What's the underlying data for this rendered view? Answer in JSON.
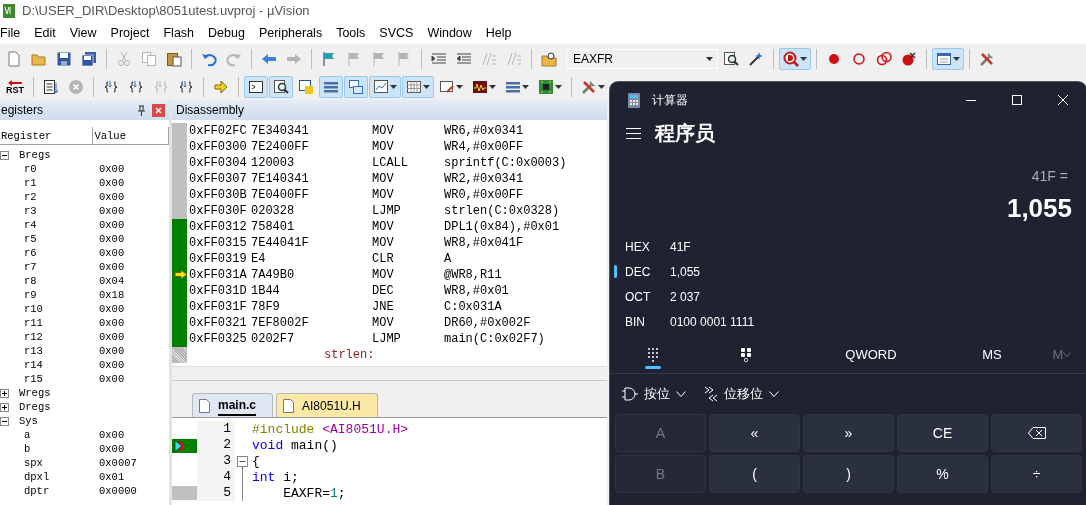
{
  "window": {
    "title": "D:\\USER_DIR\\Desktop\\8051utest.uvproj - µVision"
  },
  "menu": [
    "File",
    "Edit",
    "View",
    "Project",
    "Flash",
    "Debug",
    "Peripherals",
    "Tools",
    "SVCS",
    "Window",
    "Help"
  ],
  "toolbar_1": [
    {
      "kind": "new",
      "disabled": false,
      "pressed": false,
      "dropdown": false
    },
    {
      "kind": "open",
      "disabled": false,
      "pressed": false,
      "dropdown": false
    },
    {
      "kind": "save",
      "disabled": false,
      "pressed": false,
      "dropdown": false
    },
    {
      "kind": "saveall",
      "disabled": false,
      "pressed": false,
      "dropdown": false
    },
    {
      "kind": "separator"
    },
    {
      "kind": "cut",
      "disabled": true,
      "pressed": false,
      "dropdown": false
    },
    {
      "kind": "copy",
      "disabled": true,
      "pressed": false,
      "dropdown": false
    },
    {
      "kind": "paste",
      "disabled": false,
      "pressed": false,
      "dropdown": false
    },
    {
      "kind": "separator"
    },
    {
      "kind": "undo",
      "disabled": false,
      "pressed": false,
      "dropdown": false
    },
    {
      "kind": "redo",
      "disabled": true,
      "pressed": false,
      "dropdown": false
    },
    {
      "kind": "separator"
    },
    {
      "kind": "back",
      "disabled": false,
      "pressed": false,
      "dropdown": false
    },
    {
      "kind": "forward",
      "disabled": true,
      "pressed": false,
      "dropdown": false
    },
    {
      "kind": "separator"
    },
    {
      "kind": "flag",
      "disabled": false,
      "pressed": false,
      "dropdown": false
    },
    {
      "kind": "flag",
      "disabled": true,
      "pressed": false,
      "dropdown": false
    },
    {
      "kind": "flag",
      "disabled": true,
      "pressed": false,
      "dropdown": false
    },
    {
      "kind": "flag",
      "disabled": true,
      "pressed": false,
      "dropdown": false
    },
    {
      "kind": "separator"
    },
    {
      "kind": "indent",
      "disabled": false,
      "pressed": false,
      "dropdown": false
    },
    {
      "kind": "outdent",
      "disabled": false,
      "pressed": false,
      "dropdown": false
    },
    {
      "kind": "slashes",
      "disabled": true,
      "pressed": false,
      "dropdown": false
    },
    {
      "kind": "slashes",
      "disabled": true,
      "pressed": false,
      "dropdown": false
    },
    {
      "kind": "separator"
    },
    {
      "kind": "findfile",
      "disabled": false,
      "pressed": false,
      "dropdown": false
    },
    {
      "kind": "combo",
      "value": "EAXFR"
    },
    {
      "kind": "find",
      "disabled": false,
      "pressed": false,
      "dropdown": false
    },
    {
      "kind": "wand",
      "disabled": false,
      "pressed": false,
      "dropdown": false
    },
    {
      "kind": "separator"
    },
    {
      "kind": "debug",
      "disabled": false,
      "pressed": true,
      "dropdown": true
    },
    {
      "kind": "separator"
    },
    {
      "kind": "bp",
      "disabled": false,
      "pressed": false,
      "dropdown": false
    },
    {
      "kind": "bpo",
      "disabled": false,
      "pressed": false,
      "dropdown": false
    },
    {
      "kind": "bpx",
      "disabled": false,
      "pressed": false,
      "dropdown": false
    },
    {
      "kind": "bpkill",
      "disabled": false,
      "pressed": false,
      "dropdown": false
    },
    {
      "kind": "separator"
    },
    {
      "kind": "window",
      "disabled": false,
      "pressed": true,
      "dropdown": true
    },
    {
      "kind": "separator"
    },
    {
      "kind": "wrench",
      "disabled": false,
      "pressed": false,
      "dropdown": false
    }
  ],
  "toolbar_2": [
    {
      "kind": "rst",
      "label": "RST",
      "disabled": false,
      "pressed": false,
      "dropdown": false
    },
    {
      "kind": "separator"
    },
    {
      "kind": "list",
      "disabled": false,
      "pressed": false,
      "dropdown": false
    },
    {
      "kind": "stop",
      "disabled": true,
      "pressed": false,
      "dropdown": false
    },
    {
      "kind": "separator"
    },
    {
      "kind": "braces",
      "disabled": false,
      "pressed": false,
      "dropdown": false
    },
    {
      "kind": "braces",
      "disabled": false,
      "pressed": false,
      "dropdown": false
    },
    {
      "kind": "braces",
      "disabled": true,
      "pressed": false,
      "dropdown": false
    },
    {
      "kind": "braces",
      "disabled": false,
      "pressed": false,
      "dropdown": false
    },
    {
      "kind": "separator"
    },
    {
      "kind": "arrow",
      "disabled": false,
      "pressed": false,
      "dropdown": false
    },
    {
      "kind": "separator"
    },
    {
      "kind": "console",
      "disabled": false,
      "pressed": true,
      "dropdown": false
    },
    {
      "kind": "find",
      "disabled": false,
      "pressed": true,
      "dropdown": false
    },
    {
      "kind": "symbols",
      "disabled": false,
      "pressed": false,
      "dropdown": false
    },
    {
      "kind": "rows",
      "disabled": false,
      "pressed": true,
      "dropdown": false
    },
    {
      "kind": "windows",
      "disabled": false,
      "pressed": true,
      "dropdown": false
    },
    {
      "kind": "graph",
      "disabled": false,
      "pressed": true,
      "dropdown": true
    },
    {
      "kind": "grid",
      "disabled": false,
      "pressed": true,
      "dropdown": true
    },
    {
      "kind": "pen",
      "disabled": false,
      "pressed": false,
      "dropdown": true
    },
    {
      "kind": "wave",
      "disabled": false,
      "pressed": false,
      "dropdown": true
    },
    {
      "kind": "rows",
      "disabled": false,
      "pressed": false,
      "dropdown": true
    },
    {
      "kind": "chip",
      "disabled": false,
      "pressed": false,
      "dropdown": true
    },
    {
      "kind": "separator"
    },
    {
      "kind": "wrench",
      "disabled": false,
      "pressed": false,
      "dropdown": true
    }
  ],
  "registers_panel": {
    "title": "egisters",
    "columns": [
      "Register",
      "Value"
    ],
    "tree": [
      {
        "name": "Bregs",
        "expanded": true,
        "children": [
          {
            "name": "r0",
            "value": "0x00"
          },
          {
            "name": "r1",
            "value": "0x00"
          },
          {
            "name": "r2",
            "value": "0x00"
          },
          {
            "name": "r3",
            "value": "0x00"
          },
          {
            "name": "r4",
            "value": "0x00"
          },
          {
            "name": "r5",
            "value": "0x00"
          },
          {
            "name": "r6",
            "value": "0x00"
          },
          {
            "name": "r7",
            "value": "0x00"
          },
          {
            "name": "r8",
            "value": "0x04"
          },
          {
            "name": "r9",
            "value": "0x18"
          },
          {
            "name": "r10",
            "value": "0x00"
          },
          {
            "name": "r11",
            "value": "0x00"
          },
          {
            "name": "r12",
            "value": "0x00"
          },
          {
            "name": "r13",
            "value": "0x00"
          },
          {
            "name": "r14",
            "value": "0x00"
          },
          {
            "name": "r15",
            "value": "0x00"
          }
        ]
      },
      {
        "name": "Wregs",
        "expanded": false
      },
      {
        "name": "Dregs",
        "expanded": false
      },
      {
        "name": "Sys",
        "expanded": true,
        "children": [
          {
            "name": "a",
            "value": "0x00"
          },
          {
            "name": "b",
            "value": "0x00"
          },
          {
            "name": "spx",
            "value": "0x0007"
          },
          {
            "name": "dpxl",
            "value": "0x01"
          },
          {
            "name": "dptr",
            "value": "0x0000"
          }
        ]
      }
    ]
  },
  "disassembly": {
    "title": "Disassembly",
    "rows": [
      {
        "kind": "instruction",
        "address": "0xFF02FC",
        "opcode": "7E340341",
        "mnemonic": "MOV",
        "operands": "WR6,#0x0341",
        "color": "#c0c0c0",
        "current": false
      },
      {
        "kind": "instruction",
        "address": "0xFF0300",
        "opcode": "7E2400FF",
        "mnemonic": "MOV",
        "operands": "WR4,#0x00FF",
        "color": "#c0c0c0",
        "current": false
      },
      {
        "kind": "instruction",
        "address": "0xFF0304",
        "opcode": "120003",
        "mnemonic": "LCALL",
        "operands": "sprintf(C:0x0003)",
        "color": "#c0c0c0",
        "current": false
      },
      {
        "kind": "instruction",
        "address": "0xFF0307",
        "opcode": "7E140341",
        "mnemonic": "MOV",
        "operands": "WR2,#0x0341",
        "color": "#c0c0c0",
        "current": false
      },
      {
        "kind": "instruction",
        "address": "0xFF030B",
        "opcode": "7E0400FF",
        "mnemonic": "MOV",
        "operands": "WR0,#0x00FF",
        "color": "#c0c0c0",
        "current": false
      },
      {
        "kind": "instruction",
        "address": "0xFF030F",
        "opcode": "020328",
        "mnemonic": "LJMP",
        "operands": "strlen(C:0x0328)",
        "color": "#c0c0c0",
        "current": false
      },
      {
        "kind": "instruction",
        "address": "0xFF0312",
        "opcode": "758401",
        "mnemonic": "MOV",
        "operands": "DPL1(0x84),#0x01",
        "color": "#008000",
        "current": false
      },
      {
        "kind": "instruction",
        "address": "0xFF0315",
        "opcode": "7E44041F",
        "mnemonic": "MOV",
        "operands": "WR8,#0x041F",
        "color": "#008000",
        "current": false
      },
      {
        "kind": "instruction",
        "address": "0xFF0319",
        "opcode": "E4",
        "mnemonic": "CLR",
        "operands": "A",
        "color": "#008000",
        "current": false
      },
      {
        "kind": "instruction",
        "address": "0xFF031A",
        "opcode": "7A49B0",
        "mnemonic": "MOV",
        "operands": "@WR8,R11",
        "color": "#008000",
        "current": true
      },
      {
        "kind": "instruction",
        "address": "0xFF031D",
        "opcode": "1B44",
        "mnemonic": "DEC",
        "operands": "WR8,#0x01",
        "color": "#008000",
        "current": false
      },
      {
        "kind": "instruction",
        "address": "0xFF031F",
        "opcode": "78F9",
        "mnemonic": "JNE",
        "operands": "C:0x031A",
        "color": "#008000",
        "current": false
      },
      {
        "kind": "instruction",
        "address": "0xFF0321",
        "opcode": "7EF8002F",
        "mnemonic": "MOV",
        "operands": "DR60,#0x002F",
        "color": "#008000",
        "current": false
      },
      {
        "kind": "instruction",
        "address": "0xFF0325",
        "opcode": "0202F7",
        "mnemonic": "LJMP",
        "operands": "main(C:0x02F7)",
        "color": "#008000",
        "current": false
      },
      {
        "kind": "label",
        "text": "strlen:"
      }
    ]
  },
  "editor": {
    "tabs": [
      {
        "label": "main.c",
        "selected": true
      },
      {
        "label": "AI8051U.H",
        "selected": false
      }
    ],
    "lines": [
      {
        "number": "1",
        "breakpoint": false,
        "executed": false,
        "foldable": false,
        "tokens": [
          {
            "text": "#include ",
            "kind": "preprocessor"
          },
          {
            "text": "<AI8051U.H>",
            "kind": "header"
          }
        ]
      },
      {
        "number": "2",
        "breakpoint": true,
        "executed": false,
        "foldable": false,
        "tokens": [
          {
            "text": "void",
            "kind": "keyword"
          },
          {
            "text": " main()",
            "kind": "plain"
          }
        ]
      },
      {
        "number": "3",
        "breakpoint": false,
        "executed": false,
        "foldable": true,
        "tokens": [
          {
            "text": "{",
            "kind": "plain"
          }
        ]
      },
      {
        "number": "4",
        "breakpoint": false,
        "executed": false,
        "foldable": false,
        "tokens": [
          {
            "text": "int",
            "kind": "keyword"
          },
          {
            "text": " i;",
            "kind": "plain"
          }
        ]
      },
      {
        "number": "5",
        "breakpoint": false,
        "executed": true,
        "foldable": false,
        "tokens": [
          {
            "text": "    EAXFR=",
            "kind": "plain"
          },
          {
            "text": "1",
            "kind": "number"
          },
          {
            "text": ";",
            "kind": "plain"
          }
        ]
      }
    ]
  },
  "calculator": {
    "title": "计算器",
    "mode": "程序员",
    "expression": "41F =",
    "result": "1,055",
    "radixes": [
      {
        "name": "HEX",
        "value": "41F",
        "selected": false
      },
      {
        "name": "DEC",
        "value": "1,055",
        "selected": true
      },
      {
        "name": "OCT",
        "value": "2 037",
        "selected": false
      },
      {
        "name": "BIN",
        "value": "0100 0001 1111",
        "selected": false
      }
    ],
    "tabs": [
      {
        "kind": "keypad",
        "selected": true,
        "disabled": false
      },
      {
        "kind": "bitpad",
        "selected": false,
        "disabled": false
      },
      {
        "kind": "text",
        "label": "QWORD",
        "selected": false,
        "disabled": false
      },
      {
        "kind": "text",
        "label": "MS",
        "selected": false,
        "disabled": false
      },
      {
        "kind": "memory",
        "label": "M",
        "selected": false,
        "disabled": true
      }
    ],
    "operations": [
      {
        "kind": "bitwise",
        "label": "按位"
      },
      {
        "kind": "shift",
        "label": "位移位"
      }
    ],
    "keys": [
      {
        "kind": "text",
        "label": "A",
        "disabled": true
      },
      {
        "kind": "text",
        "label": "«",
        "disabled": false
      },
      {
        "kind": "text",
        "label": "»",
        "disabled": false
      },
      {
        "kind": "text",
        "label": "CE",
        "disabled": false
      },
      {
        "kind": "backspace",
        "disabled": false
      },
      {
        "kind": "text",
        "label": "B",
        "disabled": true
      },
      {
        "kind": "text",
        "label": "(",
        "disabled": false
      },
      {
        "kind": "text",
        "label": ")",
        "disabled": false
      },
      {
        "kind": "text",
        "label": "%",
        "disabled": false
      },
      {
        "kind": "text",
        "label": "÷",
        "disabled": false
      }
    ]
  }
}
